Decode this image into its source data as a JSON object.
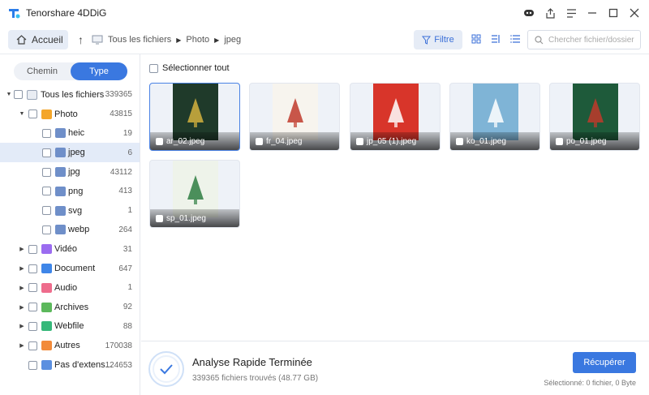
{
  "app": {
    "title": "Tenorshare 4DDiG"
  },
  "nav": {
    "home_label": "Accueil",
    "breadcrumb": [
      "Tous les fichiers",
      "Photo",
      "jpeg"
    ],
    "filter_label": "Filtre",
    "search_placeholder": "Chercher fichier/dossier"
  },
  "sidebar": {
    "tabs": [
      "Chemin",
      "Type"
    ],
    "active_tab": "Type",
    "tree": [
      {
        "label": "Tous les fichiers",
        "count": "339365",
        "level": 0,
        "expanded": true,
        "icon": "computer-icon",
        "color": "#9aa6b8"
      },
      {
        "label": "Photo",
        "count": "43815",
        "level": 1,
        "expanded": true,
        "icon": "photo-icon",
        "color": "#f4a62a"
      },
      {
        "label": "heic",
        "count": "19",
        "level": 2,
        "icon": "folder-icon",
        "color": "#6f8fc9"
      },
      {
        "label": "jpeg",
        "count": "6",
        "level": 2,
        "selected": true,
        "icon": "folder-icon",
        "color": "#6f8fc9"
      },
      {
        "label": "jpg",
        "count": "43112",
        "level": 2,
        "icon": "folder-icon",
        "color": "#6f8fc9"
      },
      {
        "label": "png",
        "count": "413",
        "level": 2,
        "icon": "folder-icon",
        "color": "#6f8fc9"
      },
      {
        "label": "svg",
        "count": "1",
        "level": 2,
        "icon": "folder-icon",
        "color": "#6f8fc9"
      },
      {
        "label": "webp",
        "count": "264",
        "level": 2,
        "icon": "folder-icon",
        "color": "#6f8fc9"
      },
      {
        "label": "Vidéo",
        "count": "31",
        "level": 1,
        "collapsed": true,
        "icon": "video-icon",
        "color": "#9b6cf0"
      },
      {
        "label": "Document",
        "count": "647",
        "level": 1,
        "collapsed": true,
        "icon": "document-icon",
        "color": "#3f86e8"
      },
      {
        "label": "Audio",
        "count": "1",
        "level": 1,
        "collapsed": true,
        "icon": "audio-icon",
        "color": "#ee6c8c"
      },
      {
        "label": "Archives",
        "count": "92",
        "level": 1,
        "collapsed": true,
        "icon": "archive-icon",
        "color": "#5cb85c"
      },
      {
        "label": "Webfile",
        "count": "88",
        "level": 1,
        "collapsed": true,
        "icon": "webfile-icon",
        "color": "#36b87a"
      },
      {
        "label": "Autres",
        "count": "170038",
        "level": 1,
        "collapsed": true,
        "icon": "other-icon",
        "color": "#f28b3a"
      },
      {
        "label": "Pas d'extens...",
        "count": "124653",
        "level": 1,
        "icon": "no-extension-icon",
        "color": "#5b8fe0"
      }
    ]
  },
  "main": {
    "select_all_label": "Sélectionner tout",
    "files": [
      {
        "name": "ar_02.jpeg",
        "bg": "#1f3a2a",
        "accent": "#d4b23e"
      },
      {
        "name": "fr_04.jpeg",
        "bg": "#f7f4ee",
        "accent": "#c0392b"
      },
      {
        "name": "jp_05 (1).jpeg",
        "bg": "#d8352a",
        "accent": "#ffffff"
      },
      {
        "name": "ko_01.jpeg",
        "bg": "#7fb4d6",
        "accent": "#ffffff"
      },
      {
        "name": "po_01.jpeg",
        "bg": "#1e5a3a",
        "accent": "#c0392b"
      },
      {
        "name": "sp_01.jpeg",
        "bg": "#eef3ea",
        "accent": "#2e7d42"
      }
    ]
  },
  "status": {
    "title": "Analyse Rapide Terminée",
    "subtitle": "339365 fichiers trouvés (48.77 GB)",
    "recover_label": "Récupérer",
    "selection_info": "Sélectionné: 0 fichier, 0 Byte"
  },
  "colors": {
    "accent": "#3a78e0",
    "selected_row": "#e3ebf8"
  }
}
